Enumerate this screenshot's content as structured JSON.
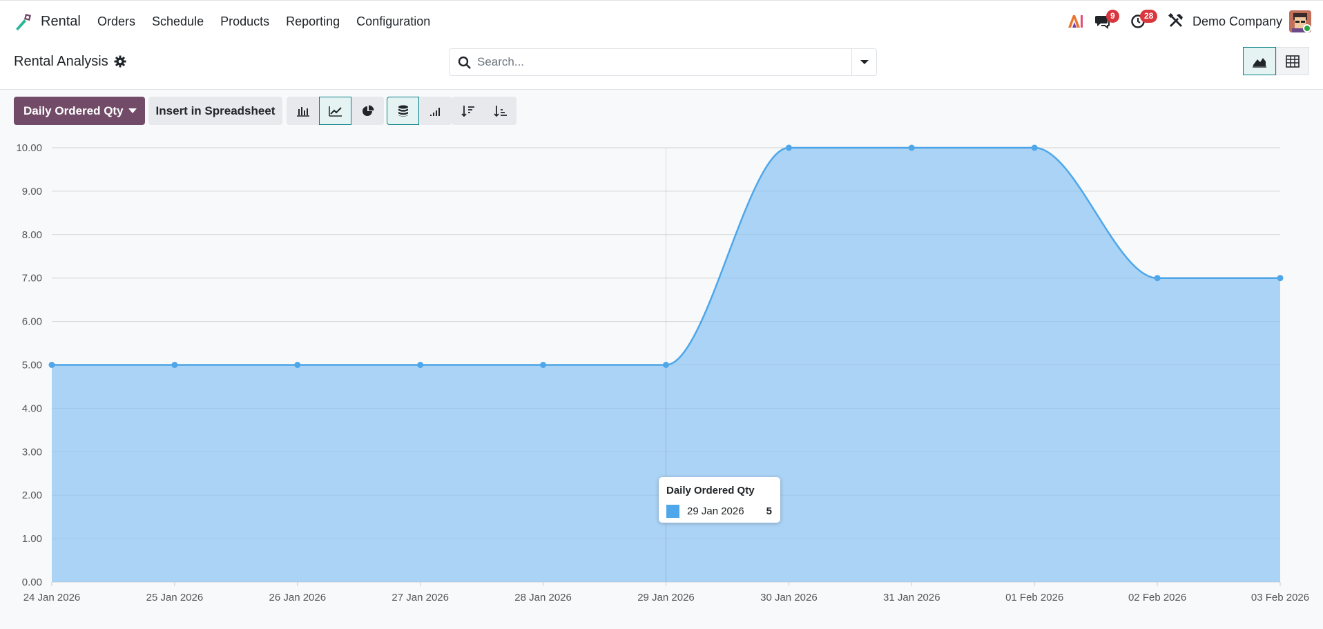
{
  "navbar": {
    "app_name": "Rental",
    "menu": [
      "Orders",
      "Schedule",
      "Products",
      "Reporting",
      "Configuration"
    ],
    "chat_count": "9",
    "activity_count": "28",
    "company": "Demo Company"
  },
  "control_panel": {
    "title": "Rental Analysis",
    "search_placeholder": "Search..."
  },
  "toolbar": {
    "measure_label": "Daily Ordered Qty",
    "spreadsheet_label": "Insert in Spreadsheet"
  },
  "tooltip": {
    "title": "Daily Ordered Qty",
    "label": "29 Jan 2026",
    "value": "5"
  },
  "colors": {
    "accent": "#714b67",
    "series": "#4ea7ea",
    "series_fill": "#a6d1f4"
  },
  "chart_data": {
    "type": "area",
    "categories": [
      "24 Jan 2026",
      "25 Jan 2026",
      "26 Jan 2026",
      "27 Jan 2026",
      "28 Jan 2026",
      "29 Jan 2026",
      "30 Jan 2026",
      "31 Jan 2026",
      "01 Feb 2026",
      "02 Feb 2026",
      "03 Feb 2026"
    ],
    "series": [
      {
        "name": "Daily Ordered Qty",
        "values": [
          5,
          5,
          5,
          5,
          5,
          5,
          10,
          10,
          10,
          7,
          7
        ]
      }
    ],
    "y_ticks": [
      "0.00",
      "1.00",
      "2.00",
      "3.00",
      "4.00",
      "5.00",
      "6.00",
      "7.00",
      "8.00",
      "9.00",
      "10.00"
    ],
    "ylim": [
      0,
      10
    ],
    "grid": true,
    "legend": "none"
  }
}
